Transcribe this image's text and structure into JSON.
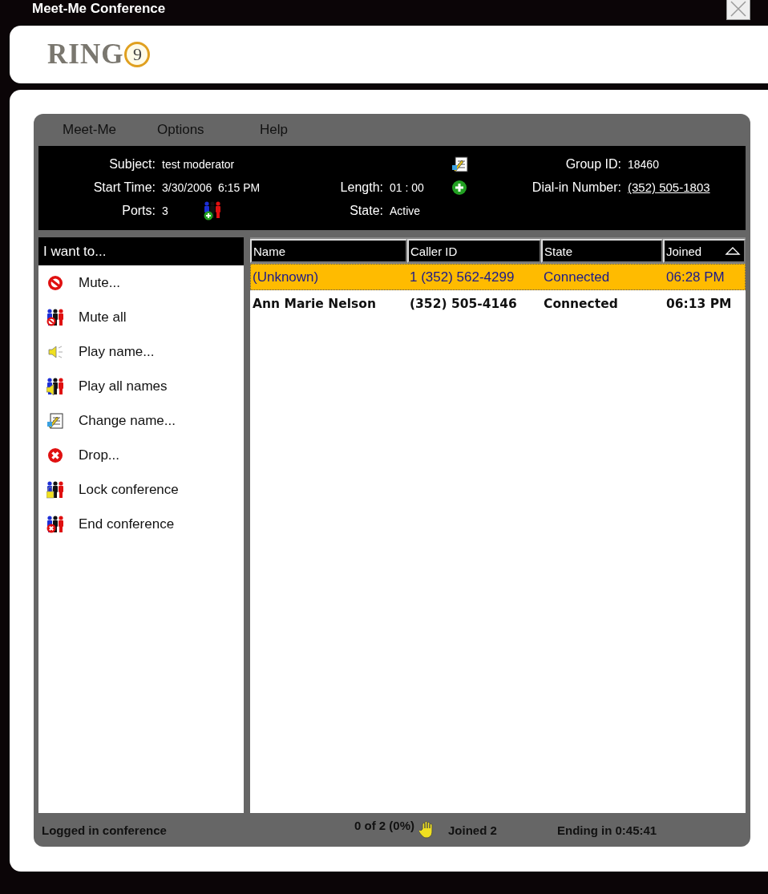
{
  "window": {
    "title": "Meet-Me Conference"
  },
  "logo": {
    "text": "RING",
    "badge": "9"
  },
  "menu": [
    "Meet-Me",
    "Options",
    "Help"
  ],
  "info": {
    "subject": {
      "label": "Subject:",
      "value": "test moderator"
    },
    "start_time": {
      "label": "Start Time:",
      "value": "3/30/2006  6:15 PM"
    },
    "ports": {
      "label": "Ports:",
      "value": "3"
    },
    "length": {
      "label": "Length:",
      "value": "01 : 00"
    },
    "state": {
      "label": "State:",
      "value": "Active"
    },
    "group_id": {
      "label": "Group ID:",
      "value": "18460"
    },
    "dial_in_number": {
      "label": "Dial-in Number:",
      "value": "(352) 505-1803"
    }
  },
  "actions": {
    "header": "I want to...",
    "items": [
      {
        "label": "Mute..."
      },
      {
        "label": "Mute all"
      },
      {
        "label": "Play name..."
      },
      {
        "label": "Play all names"
      },
      {
        "label": "Change name..."
      },
      {
        "label": "Drop..."
      },
      {
        "label": "Lock conference"
      },
      {
        "label": "End conference"
      }
    ]
  },
  "table": {
    "columns": [
      {
        "label": "Name",
        "sorted": false
      },
      {
        "label": "Caller ID",
        "sorted": false
      },
      {
        "label": "State",
        "sorted": false
      },
      {
        "label": "Joined",
        "sorted": true
      }
    ],
    "rows": [
      {
        "selected": true,
        "cells": [
          "(Unknown)",
          "1 (352) 562-4299",
          "Connected",
          "06:28 PM"
        ]
      },
      {
        "selected": false,
        "cells": [
          "Ann Marie Nelson",
          "(352) 505-4146",
          "Connected",
          "06:13 PM"
        ]
      }
    ]
  },
  "status_bar": {
    "message": "Logged in conference",
    "progress": "0 of 2 (0%)",
    "joined": "Joined 2",
    "ending": "Ending in 0:45:41"
  }
}
